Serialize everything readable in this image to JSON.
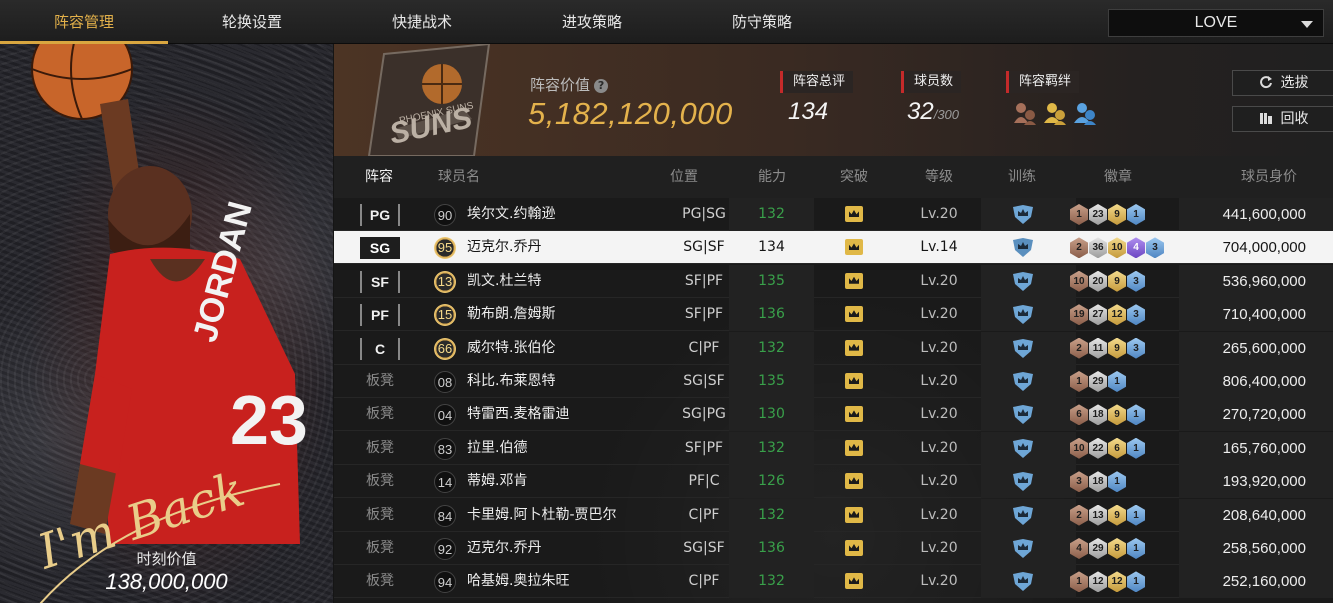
{
  "nav": {
    "tabs": [
      {
        "label": "阵容管理",
        "active": true
      },
      {
        "label": "轮换设置",
        "active": false
      },
      {
        "label": "快捷战术",
        "active": false
      },
      {
        "label": "进攻策略",
        "active": false
      },
      {
        "label": "防守策略",
        "active": false
      }
    ],
    "lineup_select": "LOVE"
  },
  "card": {
    "signature": "I'm Back",
    "value_label": "时刻价值",
    "value": "138,000,000",
    "jersey_name": "JORDAN",
    "jersey_number": "23"
  },
  "header": {
    "team_logo_text": "PHOENIX SUNS",
    "lineup_value_label": "阵容价值",
    "lineup_value": "5,182,120,000",
    "overall_label": "阵容总评",
    "overall_value": "134",
    "players_label": "球员数",
    "players_value": "32",
    "players_max": "/300",
    "bond_label": "阵容羁绊",
    "draft_button": "选拔",
    "recycle_button": "回收"
  },
  "table": {
    "headers": {
      "lineup": "阵容",
      "name": "球员名",
      "position": "位置",
      "ability": "能力",
      "breakthrough": "突破",
      "level": "等级",
      "training": "训练",
      "badges": "徽章",
      "value": "球员身价"
    },
    "rows": [
      {
        "slot": "PG",
        "bench": false,
        "rating": "90",
        "gold": false,
        "name": "埃尔文.约翰逊",
        "pos": "PG|SG",
        "ability": "132",
        "level": "Lv.20",
        "badges": [
          [
            "bronze",
            "1"
          ],
          [
            "silver",
            "23"
          ],
          [
            "gold",
            "9"
          ],
          [
            "blue",
            "1"
          ]
        ],
        "price": "441,600,000",
        "selected": false
      },
      {
        "slot": "SG",
        "bench": false,
        "rating": "95",
        "gold": true,
        "name": "迈克尔.乔丹",
        "pos": "SG|SF",
        "ability": "134",
        "level": "Lv.14",
        "badges": [
          [
            "bronze",
            "2"
          ],
          [
            "silver",
            "36"
          ],
          [
            "gold",
            "10"
          ],
          [
            "purple",
            "4"
          ],
          [
            "blue",
            "3"
          ]
        ],
        "price": "704,000,000",
        "selected": true
      },
      {
        "slot": "SF",
        "bench": false,
        "rating": "13",
        "gold": true,
        "name": "凯文.杜兰特",
        "pos": "SF|PF",
        "ability": "135",
        "level": "Lv.20",
        "badges": [
          [
            "bronze",
            "10"
          ],
          [
            "silver",
            "20"
          ],
          [
            "gold",
            "9"
          ],
          [
            "blue",
            "3"
          ]
        ],
        "price": "536,960,000",
        "selected": false
      },
      {
        "slot": "PF",
        "bench": false,
        "rating": "15",
        "gold": true,
        "name": "勒布朗.詹姆斯",
        "pos": "SF|PF",
        "ability": "136",
        "level": "Lv.20",
        "badges": [
          [
            "bronze",
            "19"
          ],
          [
            "silver",
            "27"
          ],
          [
            "gold",
            "12"
          ],
          [
            "blue",
            "3"
          ]
        ],
        "price": "710,400,000",
        "selected": false
      },
      {
        "slot": "C",
        "bench": false,
        "rating": "66",
        "gold": true,
        "name": "威尔特.张伯伦",
        "pos": "C|PF",
        "ability": "132",
        "level": "Lv.20",
        "badges": [
          [
            "bronze",
            "2"
          ],
          [
            "silver",
            "11"
          ],
          [
            "gold",
            "9"
          ],
          [
            "blue",
            "3"
          ]
        ],
        "price": "265,600,000",
        "selected": false
      },
      {
        "slot": "板凳",
        "bench": true,
        "rating": "08",
        "gold": false,
        "name": "科比.布莱恩特",
        "pos": "SG|SF",
        "ability": "135",
        "level": "Lv.20",
        "badges": [
          [
            "bronze",
            "1"
          ],
          [
            "silver",
            "29"
          ],
          [
            "blue",
            "1"
          ]
        ],
        "price": "806,400,000",
        "selected": false
      },
      {
        "slot": "板凳",
        "bench": true,
        "rating": "04",
        "gold": false,
        "name": "特雷西.麦格雷迪",
        "pos": "SG|PG",
        "ability": "130",
        "level": "Lv.20",
        "badges": [
          [
            "bronze",
            "6"
          ],
          [
            "silver",
            "18"
          ],
          [
            "gold",
            "9"
          ],
          [
            "blue",
            "1"
          ]
        ],
        "price": "270,720,000",
        "selected": false
      },
      {
        "slot": "板凳",
        "bench": true,
        "rating": "83",
        "gold": false,
        "name": "拉里.伯德",
        "pos": "SF|PF",
        "ability": "132",
        "level": "Lv.20",
        "badges": [
          [
            "bronze",
            "10"
          ],
          [
            "silver",
            "22"
          ],
          [
            "gold",
            "6"
          ],
          [
            "blue",
            "1"
          ]
        ],
        "price": "165,760,000",
        "selected": false
      },
      {
        "slot": "板凳",
        "bench": true,
        "rating": "14",
        "gold": false,
        "name": "蒂姆.邓肯",
        "pos": "PF|C",
        "ability": "126",
        "level": "Lv.20",
        "badges": [
          [
            "bronze",
            "3"
          ],
          [
            "silver",
            "18"
          ],
          [
            "blue",
            "1"
          ]
        ],
        "price": "193,920,000",
        "selected": false
      },
      {
        "slot": "板凳",
        "bench": true,
        "rating": "84",
        "gold": false,
        "name": "卡里姆.阿卜杜勒-贾巴尔",
        "pos": "C|PF",
        "ability": "132",
        "level": "Lv.20",
        "badges": [
          [
            "bronze",
            "2"
          ],
          [
            "silver",
            "13"
          ],
          [
            "gold",
            "9"
          ],
          [
            "blue",
            "1"
          ]
        ],
        "price": "208,640,000",
        "selected": false
      },
      {
        "slot": "板凳",
        "bench": true,
        "rating": "92",
        "gold": false,
        "name": "迈克尔.乔丹",
        "pos": "SG|SF",
        "ability": "136",
        "level": "Lv.20",
        "badges": [
          [
            "bronze",
            "4"
          ],
          [
            "silver",
            "29"
          ],
          [
            "gold",
            "8"
          ],
          [
            "blue",
            "1"
          ]
        ],
        "price": "258,560,000",
        "selected": false
      },
      {
        "slot": "板凳",
        "bench": true,
        "rating": "94",
        "gold": false,
        "name": "哈基姆.奥拉朱旺",
        "pos": "C|PF",
        "ability": "132",
        "level": "Lv.20",
        "badges": [
          [
            "bronze",
            "1"
          ],
          [
            "silver",
            "12"
          ],
          [
            "gold",
            "12"
          ],
          [
            "blue",
            "1"
          ]
        ],
        "price": "252,160,000",
        "selected": false
      }
    ]
  }
}
